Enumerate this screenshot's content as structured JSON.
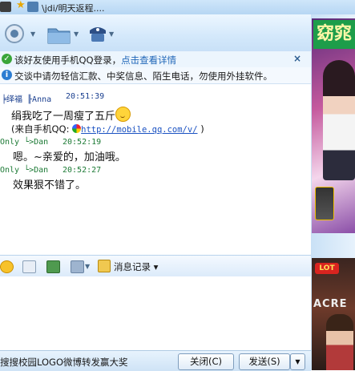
{
  "window": {
    "title": "\\jdi/明天返程...."
  },
  "notices": [
    {
      "icon": "check-circle-icon",
      "text": "该好友使用手机QQ登录，",
      "link": "点击查看详情"
    },
    {
      "icon": "info-icon",
      "text": "交谈中请勿轻信汇款、中奖信息、陌生电话，勿使用外挂软件。"
    }
  ],
  "messages": [
    {
      "sender": "╞绎福 ╟Anna",
      "time": "20:51:39",
      "lines": [
        "绢我吃了一周瘦了五斤"
      ],
      "from_line": "(来自手机QQ:",
      "link": "http://mobile.qq.com/v/",
      "from_tail": ")"
    },
    {
      "sender": "Only └>Dan",
      "time": "20:52:19",
      "lines": [
        "嗯。~亲爱的，加油哦。"
      ]
    },
    {
      "sender": "Only └>Dan",
      "time": "20:52:27",
      "lines": [
        "效果狠不错了。"
      ]
    }
  ],
  "input_toolbar": {
    "history_label": "消息记录"
  },
  "bottom_bar": {
    "promo_text": "搜搜校园LOGO微博转发赢大奖",
    "close_label": "关闭(C)",
    "send_label": "发送(S)"
  },
  "ads": {
    "top_text": "窈窕",
    "bottom_badge": "LOT",
    "bottom_text": "ACRE"
  },
  "colors": {
    "accent": "#1f66b8",
    "sender_green": "#1c7a35",
    "sender_blue": "#1a3f8f"
  }
}
